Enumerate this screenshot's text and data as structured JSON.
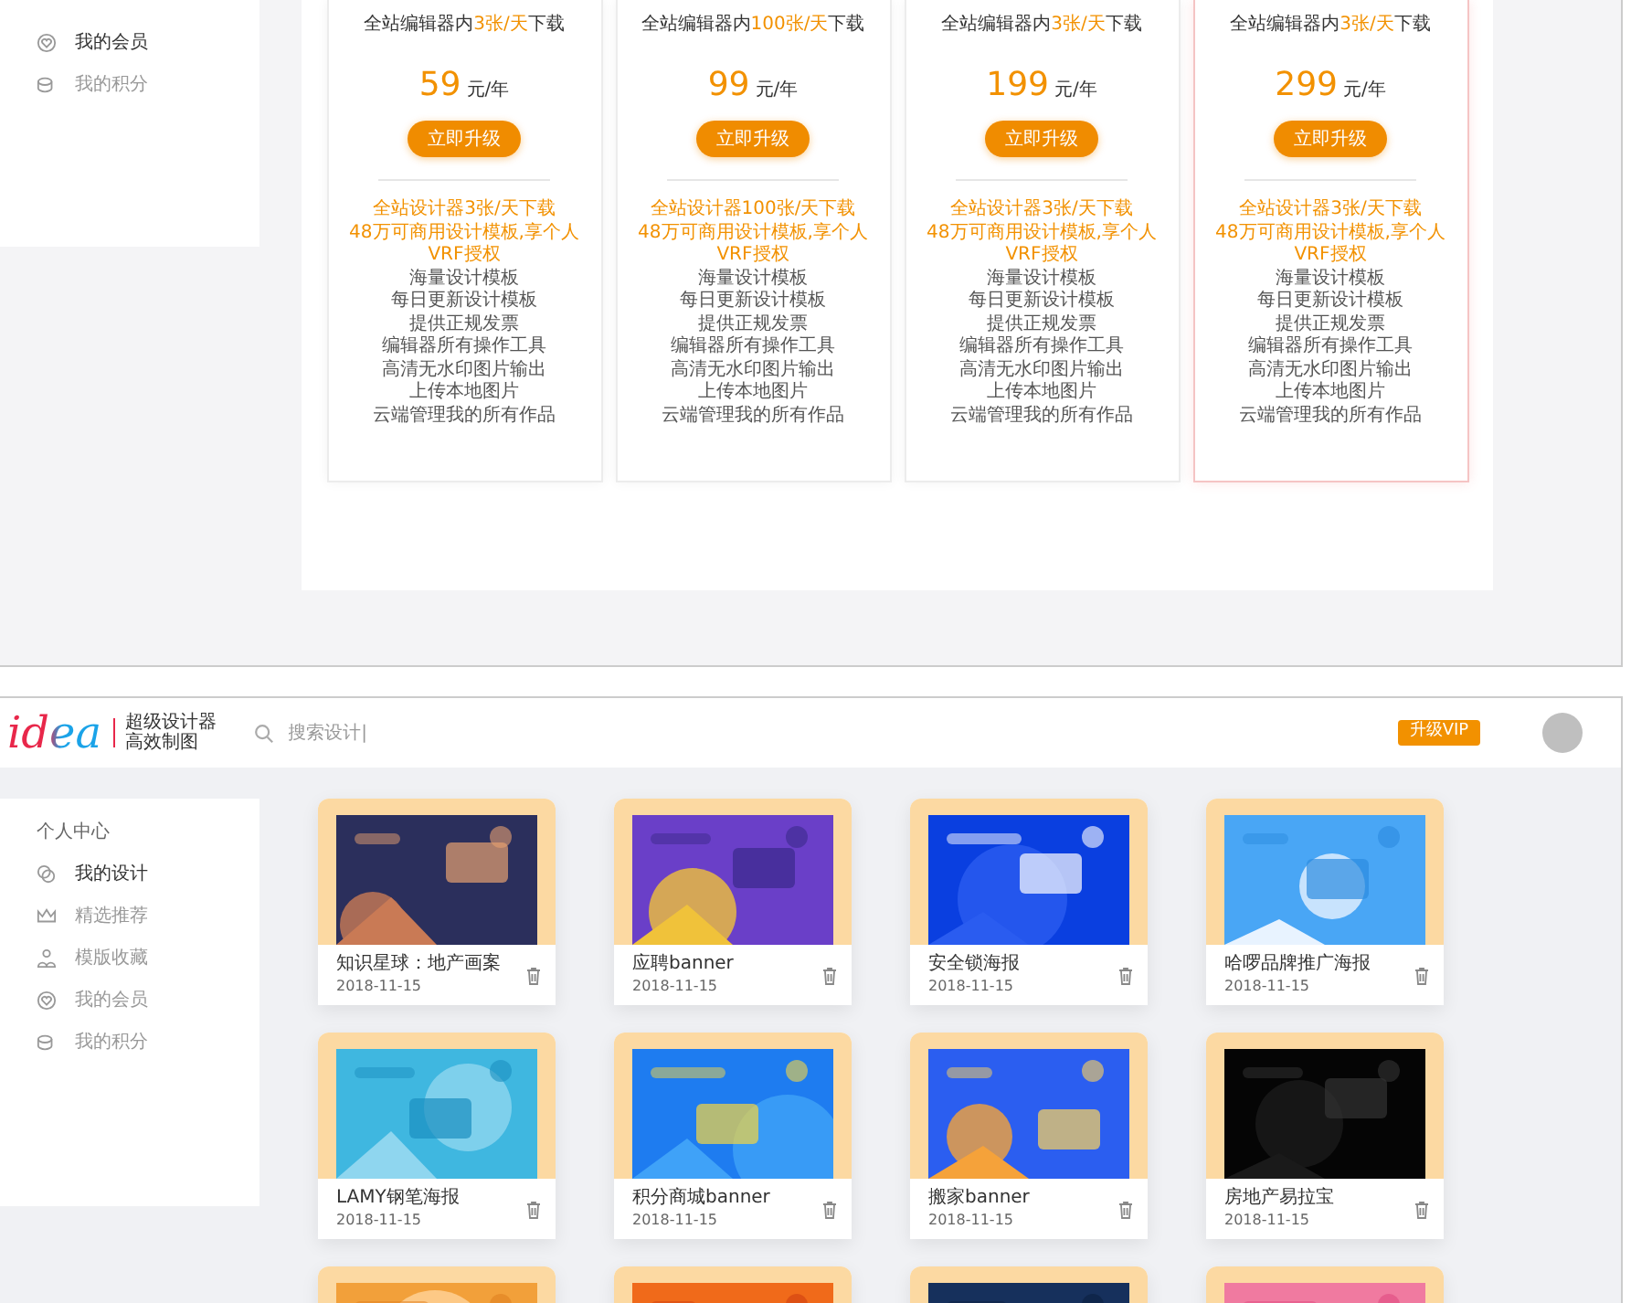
{
  "top_screen": {
    "sidebar": {
      "items": [
        {
          "label": "我的会员",
          "selected": true
        },
        {
          "label": "我的积分",
          "selected": false
        }
      ]
    },
    "plans": [
      {
        "subtitle": {
          "before": "全站编辑器内",
          "highlight": "3张/天",
          "after": "下载"
        },
        "price": "59",
        "unit": "元/年",
        "button": "立即升级",
        "selected": false,
        "features": [
          {
            "text": "全站设计器3张/天下载",
            "highlight": true
          },
          {
            "text": "48万可商用设计模板,享个人VRF授权",
            "highlight": true
          },
          {
            "text": "海量设计模板",
            "highlight": false
          },
          {
            "text": "每日更新设计模板",
            "highlight": false
          },
          {
            "text": "提供正规发票",
            "highlight": false
          },
          {
            "text": "编辑器所有操作工具",
            "highlight": false
          },
          {
            "text": "高清无水印图片输出",
            "highlight": false
          },
          {
            "text": "上传本地图片",
            "highlight": false
          },
          {
            "text": "云端管理我的所有作品",
            "highlight": false
          }
        ]
      },
      {
        "subtitle": {
          "before": "全站编辑器内",
          "highlight": "100张/天",
          "after": "下载"
        },
        "price": "99",
        "unit": "元/年",
        "button": "立即升级",
        "selected": false,
        "features": [
          {
            "text": "全站设计器100张/天下载",
            "highlight": true
          },
          {
            "text": "48万可商用设计模板,享个人VRF授权",
            "highlight": true
          },
          {
            "text": "海量设计模板",
            "highlight": false
          },
          {
            "text": "每日更新设计模板",
            "highlight": false
          },
          {
            "text": "提供正规发票",
            "highlight": false
          },
          {
            "text": "编辑器所有操作工具",
            "highlight": false
          },
          {
            "text": "高清无水印图片输出",
            "highlight": false
          },
          {
            "text": "上传本地图片",
            "highlight": false
          },
          {
            "text": "云端管理我的所有作品",
            "highlight": false
          }
        ]
      },
      {
        "subtitle": {
          "before": "全站编辑器内",
          "highlight": "3张/天",
          "after": "下载"
        },
        "price": "199",
        "unit": "元/年",
        "button": "立即升级",
        "selected": false,
        "features": [
          {
            "text": "全站设计器3张/天下载",
            "highlight": true
          },
          {
            "text": "48万可商用设计模板,享个人VRF授权",
            "highlight": true
          },
          {
            "text": "海量设计模板",
            "highlight": false
          },
          {
            "text": "每日更新设计模板",
            "highlight": false
          },
          {
            "text": "提供正规发票",
            "highlight": false
          },
          {
            "text": "编辑器所有操作工具",
            "highlight": false
          },
          {
            "text": "高清无水印图片输出",
            "highlight": false
          },
          {
            "text": "上传本地图片",
            "highlight": false
          },
          {
            "text": "云端管理我的所有作品",
            "highlight": false
          }
        ]
      },
      {
        "subtitle": {
          "before": "全站编辑器内",
          "highlight": "3张/天",
          "after": "下载"
        },
        "price": "299",
        "unit": "元/年",
        "button": "立即升级",
        "selected": true,
        "features": [
          {
            "text": "全站设计器3张/天下载",
            "highlight": true
          },
          {
            "text": "48万可商用设计模板,享个人VRF授权",
            "highlight": true
          },
          {
            "text": "海量设计模板",
            "highlight": false
          },
          {
            "text": "每日更新设计模板",
            "highlight": false
          },
          {
            "text": "提供正规发票",
            "highlight": false
          },
          {
            "text": "编辑器所有操作工具",
            "highlight": false
          },
          {
            "text": "高清无水印图片输出",
            "highlight": false
          },
          {
            "text": "上传本地图片",
            "highlight": false
          },
          {
            "text": "云端管理我的所有作品",
            "highlight": false
          }
        ]
      }
    ]
  },
  "bottom_screen": {
    "header": {
      "logo": "idea",
      "tagline": [
        "超级设计器",
        "高效制图"
      ],
      "search": {
        "placeholder": "搜索设计|"
      },
      "vip_button": "升级VIP"
    },
    "sidebar": {
      "title": "个人中心",
      "items": [
        {
          "label": "我的设计",
          "selected": true
        },
        {
          "label": "精选推荐",
          "selected": false
        },
        {
          "label": "模版收藏",
          "selected": false
        },
        {
          "label": "我的会员",
          "selected": false
        },
        {
          "label": "我的积分",
          "selected": false
        }
      ]
    },
    "designs": [
      {
        "title": "知识星球：地产画案",
        "date": "2018-11-15"
      },
      {
        "title": "应聘banner",
        "date": "2018-11-15"
      },
      {
        "title": "安全锁海报",
        "date": "2018-11-15"
      },
      {
        "title": "哈啰品牌推广海报",
        "date": "2018-11-15"
      },
      {
        "title": "LAMY钢笔海报",
        "date": "2018-11-15"
      },
      {
        "title": "积分商城banner",
        "date": "2018-11-15"
      },
      {
        "title": "搬家banner",
        "date": "2018-11-15"
      },
      {
        "title": "房地产易拉宝",
        "date": "2018-11-15"
      }
    ]
  }
}
